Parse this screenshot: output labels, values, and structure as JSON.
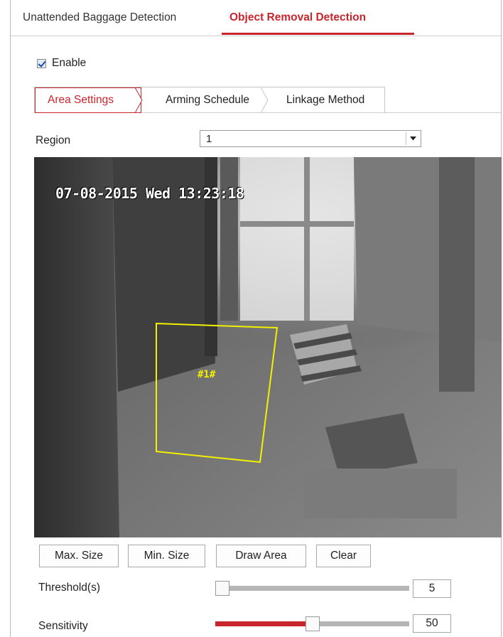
{
  "tabs": [
    {
      "label": "Unattended Baggage Detection",
      "active": false
    },
    {
      "label": "Object Removal Detection",
      "active": true
    }
  ],
  "enable": {
    "label": "Enable",
    "checked": true
  },
  "sub_tabs": [
    {
      "label": "Area Settings",
      "active": true
    },
    {
      "label": "Arming Schedule",
      "active": false
    },
    {
      "label": "Linkage Method",
      "active": false
    }
  ],
  "region": {
    "label": "Region",
    "value": "1"
  },
  "video": {
    "osd_text": "07-08-2015 Wed 13:23:18",
    "area_tag": "#1#",
    "area_color": "#f3f000"
  },
  "buttons": {
    "max_size": "Max. Size",
    "min_size": "Min. Size",
    "draw_area": "Draw Area",
    "clear": "Clear"
  },
  "threshold": {
    "label": "Threshold(s)",
    "value": "5",
    "fraction": 0.0
  },
  "sensitivity": {
    "label": "Sensitivity",
    "value": "50",
    "fraction": 0.5
  },
  "colors": {
    "accent": "#c8252c",
    "track": "#b5b5b5"
  },
  "icons": {
    "dropdown": "chevron-down-icon",
    "enable": "checkbox-checked-icon"
  }
}
